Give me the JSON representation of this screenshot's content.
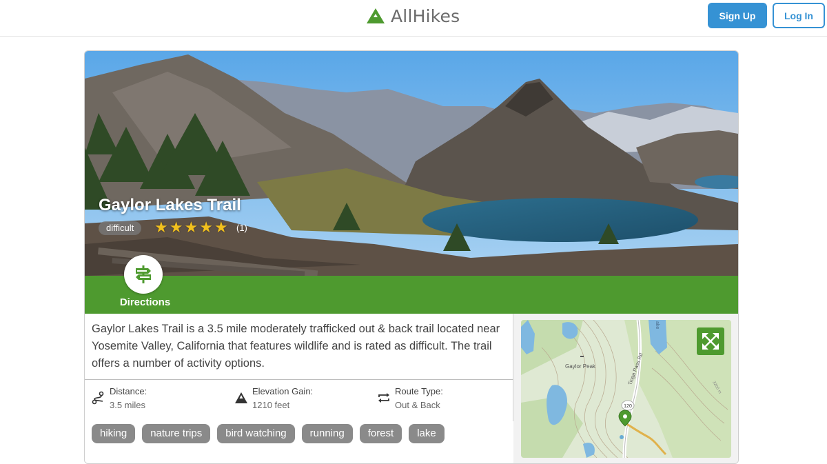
{
  "header": {
    "brand": "AllHikes",
    "signup_label": "Sign Up",
    "login_label": "Log In",
    "logo_icon": "mountain-logo-icon"
  },
  "trail": {
    "name": "Gaylor Lakes Trail",
    "difficulty": "difficult",
    "rating_stars": 5,
    "rating_count": "(1)"
  },
  "directions": {
    "label": "Directions",
    "icon": "signpost-icon"
  },
  "description": "Gaylor Lakes Trail is a 3.5 mile moderately trafficked out & back trail located near Yosemite Valley, California that features wildlife and is rated as difficult. The trail offers a number of activity options.",
  "stats": {
    "distance": {
      "label": "Distance:",
      "value": "3.5 miles",
      "icon": "route-icon"
    },
    "elevation": {
      "label": "Elevation Gain:",
      "value": "1210 feet",
      "icon": "elevation-icon"
    },
    "route": {
      "label": "Route Type:",
      "value": "Out & Back",
      "icon": "loop-arrows-icon"
    }
  },
  "tags": [
    "hiking",
    "nature trips",
    "bird watching",
    "running",
    "forest",
    "lake"
  ],
  "map": {
    "labels": {
      "peak": "Gaylor Peak",
      "road": "Tioga Pass Rd",
      "shield": "120",
      "contour": "3200 m",
      "lake": "ake"
    },
    "expand_icon": "expand-icon",
    "marker_icon": "map-pin-icon"
  },
  "colors": {
    "accent_blue": "#3592d4",
    "trail_green": "#4e9a2f",
    "star_yellow": "#f2c01d",
    "tag_gray": "#8a8a8a"
  }
}
